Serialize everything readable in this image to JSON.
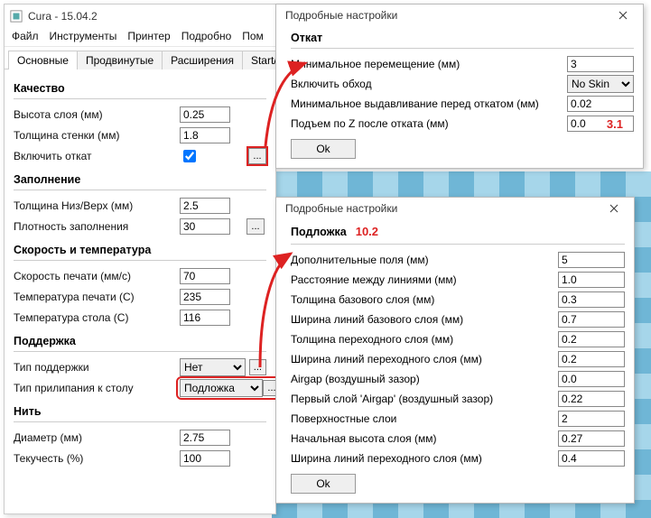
{
  "main": {
    "title": "Cura - 15.04.2",
    "menu": [
      "Файл",
      "Инструменты",
      "Принтер",
      "Подробно",
      "Пом"
    ],
    "tabs": [
      "Основные",
      "Продвинутые",
      "Расширения",
      "Start/End-GCod"
    ],
    "sections": {
      "quality": {
        "title": "Качество",
        "layer_height_label": "Высота слоя (мм)",
        "layer_height": "0.25",
        "wall_label": "Толщина стенки (мм)",
        "wall": "1.8",
        "retract_label": "Включить откат",
        "retract_checked": true,
        "dots": "..."
      },
      "fill": {
        "title": "Заполнение",
        "topbot_label": "Толщина Низ/Верх (мм)",
        "topbot": "2.5",
        "density_label": "Плотность заполнения",
        "density": "30",
        "dots": "..."
      },
      "speed": {
        "title": "Скорость и температура",
        "print_speed_label": "Скорость печати (мм/с)",
        "print_speed": "70",
        "print_temp_label": "Температура печати (C)",
        "print_temp": "235",
        "bed_temp_label": "Температура стола (C)",
        "bed_temp": "116"
      },
      "support": {
        "title": "Поддержка",
        "support_type_label": "Тип поддержки",
        "support_type": "Нет",
        "adhesion_label": "Тип прилипания к столу",
        "adhesion": "Подложка",
        "dots": "..."
      },
      "filament": {
        "title": "Нить",
        "diameter_label": "Диаметр (мм)",
        "diameter": "2.75",
        "flow_label": "Текучесть (%)",
        "flow": "100"
      }
    }
  },
  "dialog1": {
    "title": "Подробные настройки",
    "section": "Откат",
    "rows": {
      "min_travel_label": "Минимальное перемещение (мм)",
      "min_travel": "3",
      "combing_label": "Включить обход",
      "combing": "No Skin",
      "min_extrude_label": "Минимальное выдавливание перед откатом (мм)",
      "min_extrude": "0.02",
      "zhop_label": "Подъем по Z после отката (мм)",
      "zhop": "0.0"
    },
    "anno": "3.1",
    "ok": "Ok"
  },
  "dialog2": {
    "title": "Подробные настройки",
    "section": "Подложка",
    "anno": "10.2",
    "rows": {
      "extra_margin_label": "Дополнительные поля (мм)",
      "extra_margin": "5",
      "line_spacing_label": "Расстояние между линиями (мм)",
      "line_spacing": "1.0",
      "base_thick_label": "Толщина базового слоя (мм)",
      "base_thick": "0.3",
      "base_linew_label": "Ширина линий базового слоя (мм)",
      "base_linew": "0.7",
      "iface_thick_label": "Толщина переходного слоя (мм)",
      "iface_thick": "0.2",
      "iface_linew_label": "Ширина линий переходного слоя (мм)",
      "iface_linew": "0.2",
      "airgap_label": "Airgap (воздушный зазор)",
      "airgap": "0.0",
      "first_airgap_label": "Первый слой 'Airgap' (воздушный зазор)",
      "first_airgap": "0.22",
      "surf_layers_label": "Поверхностные слои",
      "surf_layers": "2",
      "surf_thick_label": "Начальная высота слоя (мм)",
      "surf_thick": "0.27",
      "surf_linew_label": "Ширина линий переходного слоя (мм)",
      "surf_linew": "0.4"
    },
    "ok": "Ok"
  }
}
